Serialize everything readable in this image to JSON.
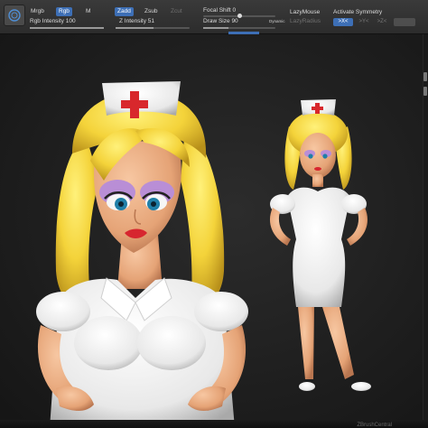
{
  "toolbar": {
    "mrgb": "Mrgb",
    "rgb": "Rgb",
    "m": "M",
    "rgb_intensity_label": "Rgb Intensity",
    "rgb_intensity_value": "100",
    "zadd": "Zadd",
    "zsub": "Zsub",
    "zcut": "Zcut",
    "z_intensity_label": "Z Intensity",
    "z_intensity_value": "51",
    "focal_shift_label": "Focal Shift",
    "focal_shift_value": "0",
    "draw_size_label": "Draw Size",
    "draw_size_value": "90",
    "dynamic": "Dynamic",
    "lazy_mouse": "LazyMouse",
    "lazy_radius": "LazyRadius",
    "activate_symmetry": "Activate Symmetry",
    "sym_x": ">X<",
    "sym_y": ">Y<",
    "sym_z": ">Z<"
  },
  "sliders": {
    "rgb_intensity": 1.0,
    "z_intensity": 0.51,
    "focal_shift": 0.5,
    "draw_size": 0.35
  },
  "colors": {
    "accent": "#3d6fb6",
    "hair": "#f4d33a",
    "skin": "#e8a97e",
    "uniform": "#f2f2f2",
    "cross": "#d8282c",
    "background": "#1f1f1f"
  },
  "status": {
    "bottom_text": "ZBrushCentral"
  }
}
